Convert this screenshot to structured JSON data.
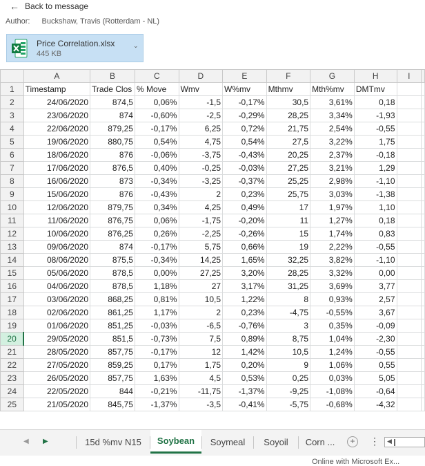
{
  "nav": {
    "back_label": "Back to message"
  },
  "author": {
    "label": "Author:",
    "name": "Buckshaw, Travis (Rotterdam - NL)"
  },
  "attachment": {
    "file_name": "Price Correlation.xlsx",
    "file_size": "445 KB",
    "icon": "excel-file-icon"
  },
  "grid": {
    "column_letters": [
      "A",
      "B",
      "C",
      "D",
      "E",
      "F",
      "G",
      "H",
      "I"
    ],
    "headers": [
      "Timestamp",
      "Trade Clos",
      "% Move",
      "Wmv",
      "W%mv",
      "Mthmv",
      "Mth%mv",
      "DMTmv"
    ],
    "active_row": 20,
    "rows": [
      [
        "24/06/2020",
        "874,5",
        "0,06%",
        "-1,5",
        "-0,17%",
        "30,5",
        "3,61%",
        "0,18"
      ],
      [
        "23/06/2020",
        "874",
        "-0,60%",
        "-2,5",
        "-0,29%",
        "28,25",
        "3,34%",
        "-1,93"
      ],
      [
        "22/06/2020",
        "879,25",
        "-0,17%",
        "6,25",
        "0,72%",
        "21,75",
        "2,54%",
        "-0,55"
      ],
      [
        "19/06/2020",
        "880,75",
        "0,54%",
        "4,75",
        "0,54%",
        "27,5",
        "3,22%",
        "1,75"
      ],
      [
        "18/06/2020",
        "876",
        "-0,06%",
        "-3,75",
        "-0,43%",
        "20,25",
        "2,37%",
        "-0,18"
      ],
      [
        "17/06/2020",
        "876,5",
        "0,40%",
        "-0,25",
        "-0,03%",
        "27,25",
        "3,21%",
        "1,29"
      ],
      [
        "16/06/2020",
        "873",
        "-0,34%",
        "-3,25",
        "-0,37%",
        "25,25",
        "2,98%",
        "-1,10"
      ],
      [
        "15/06/2020",
        "876",
        "-0,43%",
        "2",
        "0,23%",
        "25,75",
        "3,03%",
        "-1,38"
      ],
      [
        "12/06/2020",
        "879,75",
        "0,34%",
        "4,25",
        "0,49%",
        "17",
        "1,97%",
        "1,10"
      ],
      [
        "11/06/2020",
        "876,75",
        "0,06%",
        "-1,75",
        "-0,20%",
        "11",
        "1,27%",
        "0,18"
      ],
      [
        "10/06/2020",
        "876,25",
        "0,26%",
        "-2,25",
        "-0,26%",
        "15",
        "1,74%",
        "0,83"
      ],
      [
        "09/06/2020",
        "874",
        "-0,17%",
        "5,75",
        "0,66%",
        "19",
        "2,22%",
        "-0,55"
      ],
      [
        "08/06/2020",
        "875,5",
        "-0,34%",
        "14,25",
        "1,65%",
        "32,25",
        "3,82%",
        "-1,10"
      ],
      [
        "05/06/2020",
        "878,5",
        "0,00%",
        "27,25",
        "3,20%",
        "28,25",
        "3,32%",
        "0,00"
      ],
      [
        "04/06/2020",
        "878,5",
        "1,18%",
        "27",
        "3,17%",
        "31,25",
        "3,69%",
        "3,77"
      ],
      [
        "03/06/2020",
        "868,25",
        "0,81%",
        "10,5",
        "1,22%",
        "8",
        "0,93%",
        "2,57"
      ],
      [
        "02/06/2020",
        "861,25",
        "1,17%",
        "2",
        "0,23%",
        "-4,75",
        "-0,55%",
        "3,67"
      ],
      [
        "01/06/2020",
        "851,25",
        "-0,03%",
        "-6,5",
        "-0,76%",
        "3",
        "0,35%",
        "-0,09"
      ],
      [
        "29/05/2020",
        "851,5",
        "-0,73%",
        "7,5",
        "0,89%",
        "8,75",
        "1,04%",
        "-2,30"
      ],
      [
        "28/05/2020",
        "857,75",
        "-0,17%",
        "12",
        "1,42%",
        "10,5",
        "1,24%",
        "-0,55"
      ],
      [
        "27/05/2020",
        "859,25",
        "0,17%",
        "1,75",
        "0,20%",
        "9",
        "1,06%",
        "0,55"
      ],
      [
        "26/05/2020",
        "857,75",
        "1,63%",
        "4,5",
        "0,53%",
        "0,25",
        "0,03%",
        "5,05"
      ],
      [
        "22/05/2020",
        "844",
        "-0,21%",
        "-11,75",
        "-1,37%",
        "-9,25",
        "-1,08%",
        "-0,64"
      ],
      [
        "21/05/2020",
        "845,75",
        "-1,37%",
        "-3,5",
        "-0,41%",
        "-5,75",
        "-0,68%",
        "-4,32"
      ]
    ]
  },
  "tabs": {
    "items": [
      "15d %mv N15",
      "Soybean",
      "Soymeal",
      "Soyoil",
      "Corn ..."
    ],
    "active": "Soybean"
  },
  "status": {
    "text": "Online with Microsoft Ex..."
  },
  "colors": {
    "accent_green": "#217346",
    "attachment_bg": "#c7e0f4"
  }
}
